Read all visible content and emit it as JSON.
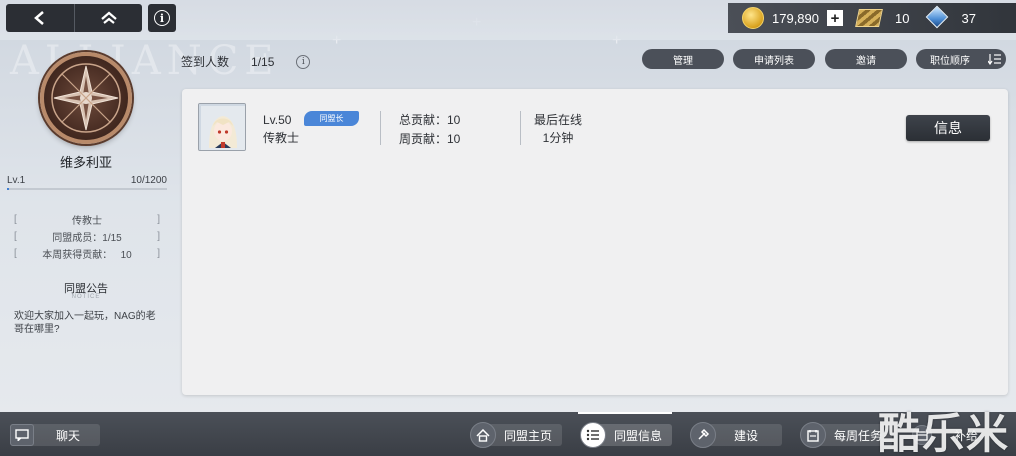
{
  "background": {
    "watermark_text": "ALLIANCE"
  },
  "topbar": {
    "icons": {
      "back": "back-arrow-icon",
      "home": "home-chevron-icon",
      "info": "info-icon"
    },
    "currencies": [
      {
        "icon": "gold-coin-icon",
        "value": "179,890"
      },
      {
        "icon": "ticket-icon",
        "value": "10"
      },
      {
        "icon": "gem-icon",
        "value": "37"
      }
    ]
  },
  "sidebar": {
    "name": "维多利亚",
    "level": "Lv.1",
    "exp": "10/1200",
    "exp_fraction": 0.008,
    "stats": [
      "传教士",
      "同盟成员：1/15",
      "本周获得贡献：   10"
    ],
    "notice_title": "同盟公告",
    "notice_sub": "NOTICE",
    "notice_text": "欢迎大家加入一起玩，NAG的老哥在哪里?"
  },
  "header": {
    "checkin_label": "签到人数",
    "checkin_value": "1/15",
    "buttons": [
      "管理",
      "申请列表",
      "邀请",
      "职位顺序"
    ]
  },
  "member": {
    "level": "Lv.50",
    "role": "同盟长",
    "class": "传教士",
    "total_contrib": "总贡献：10",
    "weekly_contrib": "周贡献：10",
    "last_online_label": "最后在线",
    "last_online_value": "1分钟",
    "info_button": "信息"
  },
  "bottombar": {
    "tabs": [
      {
        "label": "聊天",
        "icon": "chat-icon"
      },
      {
        "label": "同盟主页",
        "icon": "home-icon"
      },
      {
        "label": "同盟信息",
        "icon": "list-icon"
      },
      {
        "label": "建设",
        "icon": "build-icon"
      },
      {
        "label": "每周任务",
        "icon": "task-icon"
      },
      {
        "label": "补给",
        "icon": "supply-icon"
      }
    ]
  },
  "watermark": "酷乐米",
  "colors": {
    "accent": "#4a86d8",
    "dark_button": "#2b2e34",
    "panel": "#f0f0f1"
  }
}
